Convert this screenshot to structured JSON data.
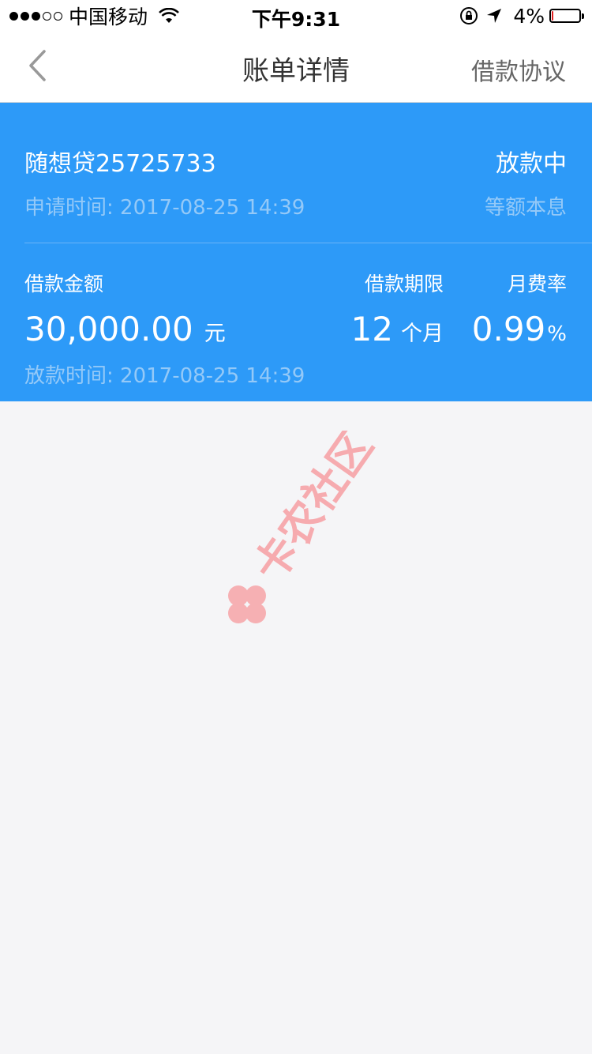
{
  "status_bar": {
    "carrier": "中国移动",
    "time": "下午9:31",
    "battery": "4%",
    "battery_level": 0.04,
    "signal_filled": 3,
    "signal_total": 5
  },
  "nav": {
    "title": "账单详情",
    "right_label": "借款协议",
    "back_icon": "chevron-left-icon"
  },
  "loan": {
    "name": "随想贷25725733",
    "status": "放款中",
    "apply_time": "申请时间: 2017-08-25 14:39",
    "repay_method": "等额本息",
    "amount_label": "借款金额",
    "amount_value": "30,000.00",
    "amount_unit": "元",
    "term_label": "借款期限",
    "term_value": "12",
    "term_unit": "个月",
    "rate_label": "月费率",
    "rate_value": "0.99",
    "rate_unit": "%",
    "disburse_time": "放款时间: 2017-08-25 14:39"
  },
  "watermark": {
    "text": "卡农社区"
  },
  "colors": {
    "accent_blue": "#2d9af8",
    "faded_text": "#94c9f8",
    "background": "#f5f5f7",
    "watermark": "#f7a4a8"
  }
}
